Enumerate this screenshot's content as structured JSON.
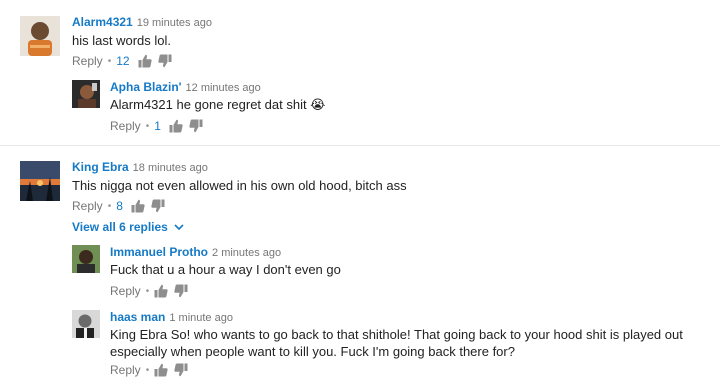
{
  "comments": [
    {
      "author": "Alarm4321",
      "time": "19 minutes ago",
      "text": "his last words lol.",
      "reply_label": "Reply",
      "likes": "12",
      "avatar_color": "#d9792e",
      "replies": [
        {
          "author": "Apha Blazin'",
          "time": "12 minutes ago",
          "text": "Alarm4321 he gone regret dat shit 😭",
          "reply_label": "Reply",
          "likes": "1",
          "avatar_color": "#5b3a29"
        }
      ]
    },
    {
      "author": "King Ebra",
      "time": "18 minutes ago",
      "text": "This nigga not even allowed in his own old hood, bitch ass",
      "reply_label": "Reply",
      "likes": "8",
      "avatar_color": "#3a4a6b",
      "view_all": "View all 6 replies",
      "replies": [
        {
          "author": "Immanuel Protho",
          "time": "2 minutes ago",
          "text": "Fuck that u a hour a way I don't even go",
          "reply_label": "Reply",
          "likes": "",
          "avatar_color": "#4a6b3a"
        },
        {
          "author": "haas man",
          "time": "1 minute ago",
          "text": "King Ebra So! who wants to go back to that shithole! That going back to your hood shit is played out especially when people want to kill you. Fuck I'm going back there for?",
          "reply_label": "Reply",
          "likes": "",
          "avatar_color": "#555555"
        }
      ]
    }
  ],
  "icons": {
    "like": "thumbs-up-icon",
    "dislike": "thumbs-down-icon",
    "chevron": "chevron-down-icon"
  },
  "colors": {
    "author": "#167ac6",
    "meta": "#767676",
    "text": "#222222"
  }
}
